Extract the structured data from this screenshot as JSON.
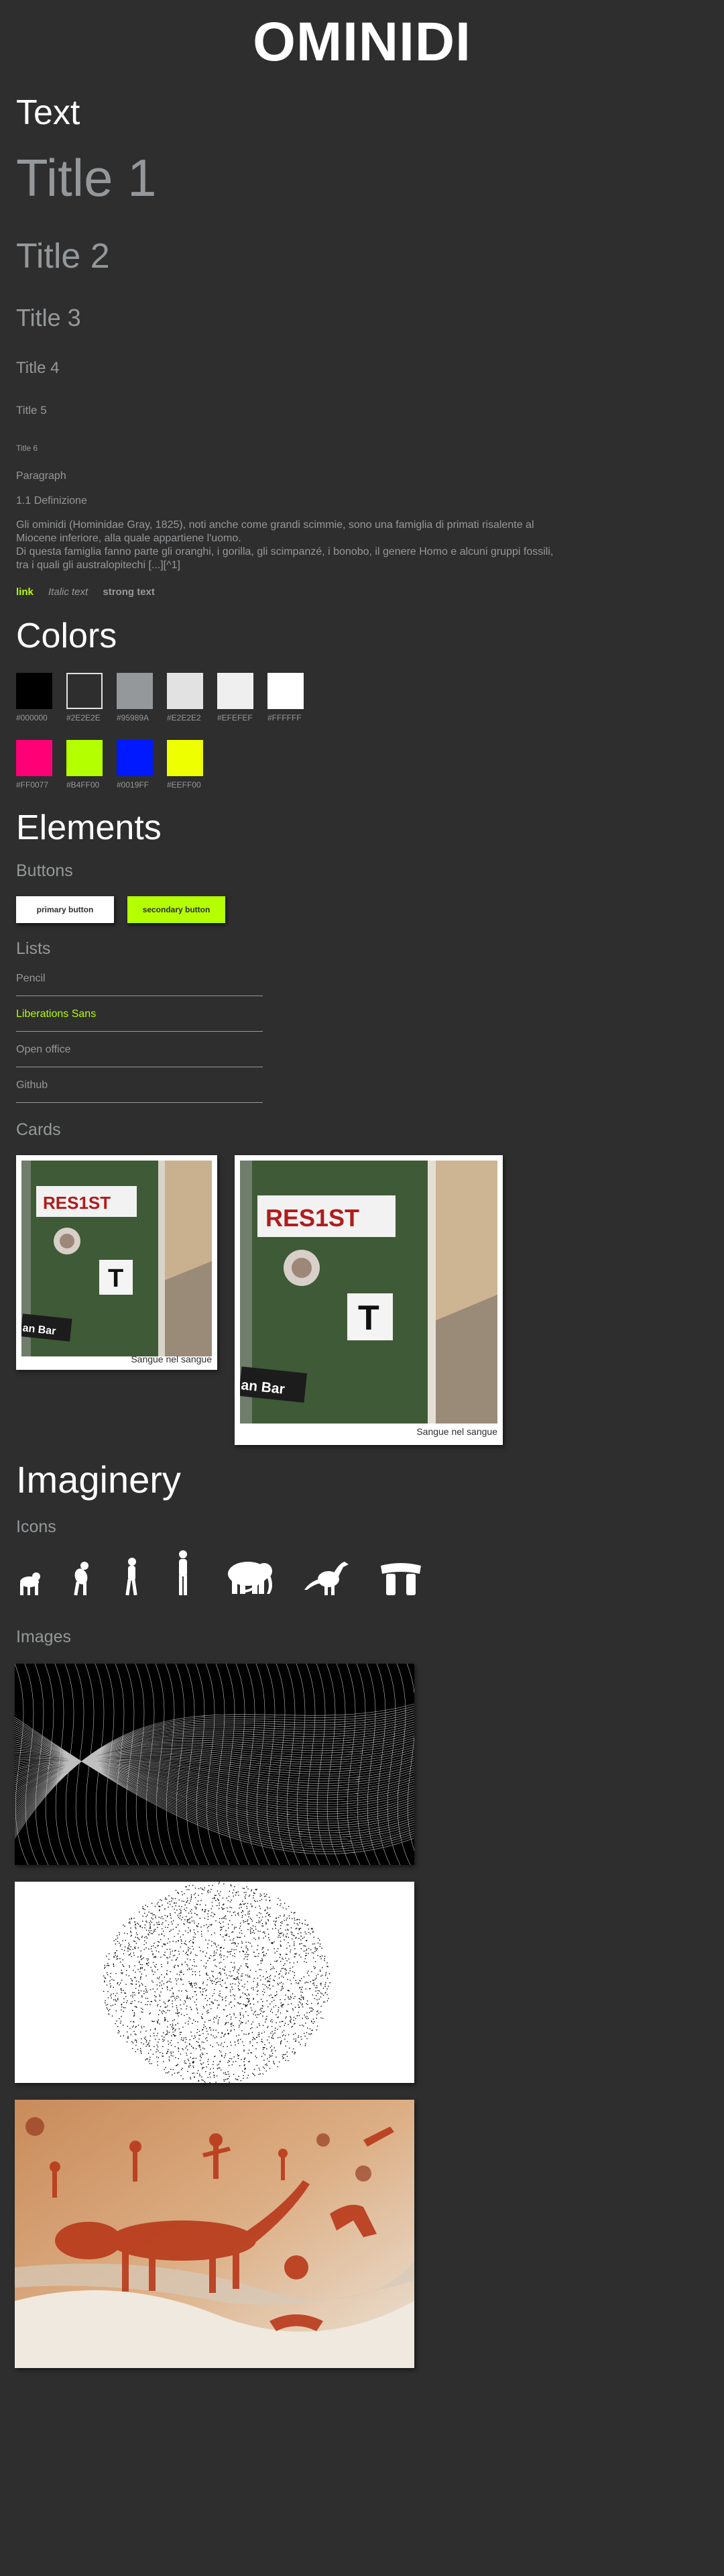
{
  "site": {
    "title": "OMINIDI"
  },
  "text_section": {
    "heading": "Text",
    "title1": "Title 1",
    "title2": "Title 2",
    "title3": "Title 3",
    "title4": "Title 4",
    "title5": "Title 5",
    "title6": "Title 6",
    "paragraph_label": "Paragraph",
    "definition_label": "1.1 Definizione",
    "paragraph_lines": [
      "Gli ominidi (Hominidae Gray, 1825), noti anche come grandi scimmie, sono una famiglia di primati risalente al",
      "Miocene inferiore, alla quale appartiene l'uomo.",
      "Di questa famiglia fanno parte gli oranghi, i gorilla, gli scimpanzé, i bonobo, il genere Homo e alcuni gruppi fossili,",
      "tra i quali gli australopitechi [...][^1]"
    ],
    "link": "link",
    "italic": "Italic text",
    "strong": "strong text"
  },
  "colors_section": {
    "heading": "Colors",
    "swatches": [
      {
        "hex": "#000000",
        "label": "#000000"
      },
      {
        "hex": "#2E2E2E",
        "label": "#2E2E2E"
      },
      {
        "hex": "#95989A",
        "label": "#95989A"
      },
      {
        "hex": "#E2E2E2",
        "label": "#E2E2E2"
      },
      {
        "hex": "#EFEFEF",
        "label": "#EFEFEF"
      },
      {
        "hex": "#FFFFFF",
        "label": "#FFFFFF"
      },
      {
        "hex": "#FF0077",
        "label": "#FF0077"
      },
      {
        "hex": "#B4FF00",
        "label": "#B4FF00"
      },
      {
        "hex": "#0019FF",
        "label": "#0019FF"
      },
      {
        "hex": "#EEFF00",
        "label": "#EEFF00"
      }
    ]
  },
  "elements_section": {
    "heading": "Elements",
    "buttons_label": "Buttons",
    "primary_button": "primary button",
    "secondary_button": "secondary button",
    "lists_label": "Lists",
    "list_items": [
      "Pencil",
      "Liberations Sans",
      "Open office",
      "Github"
    ],
    "cards_label": "Cards",
    "cards": [
      {
        "caption": "Sangue nel sangue",
        "sign": "RES1ST",
        "letter": "T",
        "bar": "an Bar"
      },
      {
        "caption": "Sangue nel sangue",
        "sign": "RES1ST",
        "letter": "T",
        "bar": "an Bar"
      }
    ]
  },
  "imaginery_section": {
    "heading": "Imaginery",
    "icons_label": "Icons",
    "icons": [
      "primate-crawling-icon",
      "primate-crouching-icon",
      "hominid-walking-icon",
      "human-standing-icon",
      "mammoth-icon",
      "dinosaur-icon",
      "dolmen-icon"
    ],
    "images_label": "Images"
  },
  "theme": {
    "background": "#2E2E2E",
    "text_muted": "#95989A",
    "accent": "#B4FF00"
  }
}
